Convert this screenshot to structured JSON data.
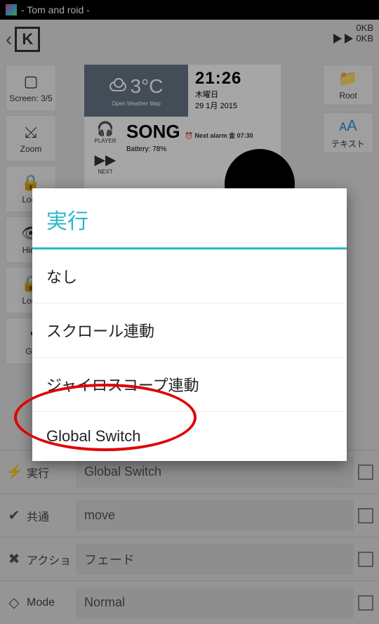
{
  "statusbar": {
    "title": "- Tom and roid -",
    "kb_up": "0KB",
    "kb_down": "0KB"
  },
  "actionbar": {
    "net_up": "0KB",
    "net_down": "0KB"
  },
  "left_tools": [
    {
      "label": "Screen: 3/5",
      "icon": "▢"
    },
    {
      "label": "Zoom",
      "icon": "⤩"
    },
    {
      "label": "Lock",
      "icon": "🔒"
    },
    {
      "label": "Hide",
      "icon": "👁"
    },
    {
      "label": "Lock",
      "icon": "🔒"
    },
    {
      "label": "Gy",
      "icon": "◔"
    }
  ],
  "right_tools": [
    {
      "label": "Root",
      "icon": "📁"
    },
    {
      "label": "テキスト",
      "icon": "ᴀA"
    }
  ],
  "preview": {
    "temp": "3°C",
    "owm": "Open Weather Map",
    "time": "21:26",
    "day": "木曜日",
    "date": "29 1月 2015",
    "player_label": "PLAYER",
    "next_label": "NEXT",
    "song": "SONG",
    "alarm": "⏰ Next alarm 金 07:30",
    "battery": "Battery: 78%"
  },
  "props": [
    {
      "icon": "⚡",
      "label": "実行",
      "value": "Global Switch"
    },
    {
      "icon": "✔",
      "label": "共通",
      "value": "move"
    },
    {
      "icon": "✖",
      "label": "アクショ",
      "value": "フェード"
    },
    {
      "icon": "◇",
      "label": "Mode",
      "value": "Normal"
    }
  ],
  "dialog": {
    "title": "実行",
    "items": [
      "なし",
      "スクロール連動",
      "ジャイロスコープ連動",
      "Global Switch"
    ]
  }
}
